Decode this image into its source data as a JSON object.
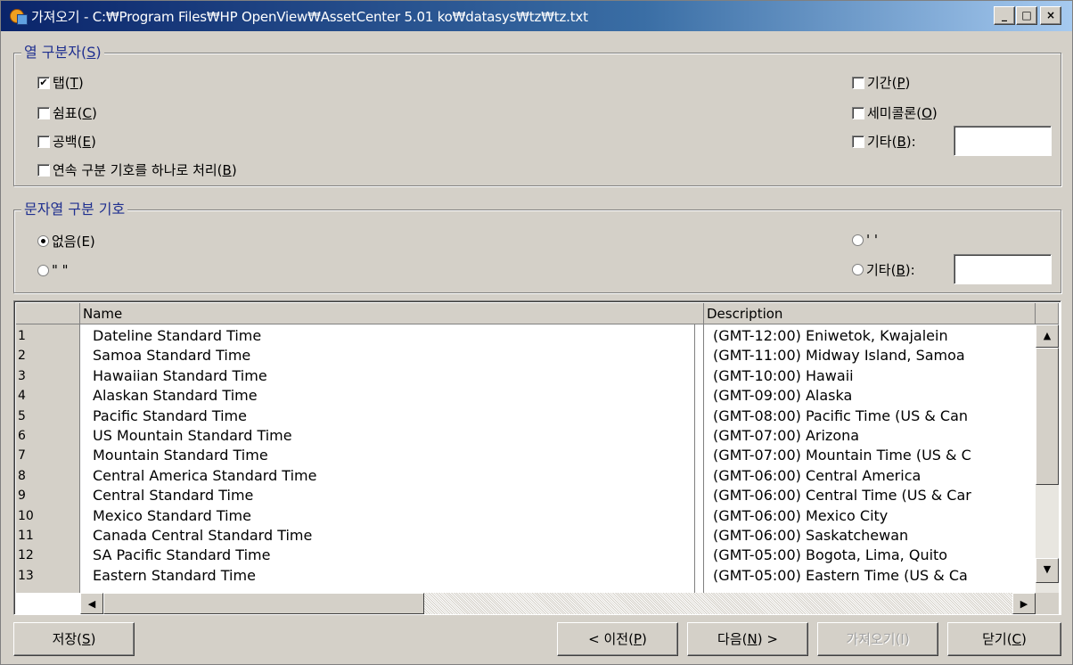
{
  "window": {
    "title": "가져오기 - C:₩Program Files₩HP OpenView₩AssetCenter 5.01 ko₩datasys₩tz₩tz.txt",
    "minimize": "_",
    "maximize": "□",
    "close": "×"
  },
  "column_separator": {
    "legend_pre": "열 구분자(",
    "legend_key": "S",
    "legend_post": ")",
    "tab": {
      "pre": "탭(",
      "key": "T",
      "post": ")",
      "checked": true
    },
    "comma": {
      "pre": "쉼표(",
      "key": "C",
      "post": ")",
      "checked": false
    },
    "space": {
      "pre": "공백(",
      "key": "E",
      "post": ")",
      "checked": false
    },
    "merge": {
      "pre": "연속 구분 기호를 하나로 처리(",
      "key": "B",
      "post": ")",
      "checked": false
    },
    "period": {
      "pre": "기간(",
      "key": "P",
      "post": ")",
      "checked": false
    },
    "semicolon": {
      "pre": "세미콜론(",
      "key": "O",
      "post": ")",
      "checked": false
    },
    "other": {
      "pre": "기타(",
      "key": "B",
      "post": "):",
      "checked": false,
      "value": ""
    }
  },
  "string_delimiter": {
    "legend": "문자열 구분 기호",
    "none": {
      "label": "없음(E)",
      "selected": true
    },
    "single_quote": {
      "label": "' '",
      "selected": false
    },
    "double_quote": {
      "label": "\" \"",
      "selected": false
    },
    "other": {
      "pre": "기타(",
      "key": "B",
      "post": "):",
      "selected": false,
      "value": ""
    }
  },
  "grid": {
    "columns": [
      "Name",
      "Description"
    ],
    "rows": [
      {
        "num": "1",
        "name": "Dateline Standard Time",
        "desc": "(GMT-12:00) Eniwetok, Kwajalein"
      },
      {
        "num": "2",
        "name": "Samoa Standard Time",
        "desc": "(GMT-11:00) Midway Island, Samoa"
      },
      {
        "num": "3",
        "name": "Hawaiian Standard Time",
        "desc": "(GMT-10:00) Hawaii"
      },
      {
        "num": "4",
        "name": "Alaskan Standard Time",
        "desc": "(GMT-09:00) Alaska"
      },
      {
        "num": "5",
        "name": "Pacific Standard Time",
        "desc": "(GMT-08:00) Pacific Time (US & Can"
      },
      {
        "num": "6",
        "name": "US Mountain Standard Time",
        "desc": "(GMT-07:00) Arizona"
      },
      {
        "num": "7",
        "name": "Mountain Standard Time",
        "desc": "(GMT-07:00) Mountain Time (US & C"
      },
      {
        "num": "8",
        "name": "Central America Standard Time",
        "desc": "(GMT-06:00) Central America"
      },
      {
        "num": "9",
        "name": "Central Standard Time",
        "desc": "(GMT-06:00) Central Time (US & Car"
      },
      {
        "num": "10",
        "name": "Mexico Standard Time",
        "desc": "(GMT-06:00) Mexico City"
      },
      {
        "num": "11",
        "name": "Canada Central Standard Time",
        "desc": "(GMT-06:00) Saskatchewan"
      },
      {
        "num": "12",
        "name": "SA Pacific Standard Time",
        "desc": "(GMT-05:00) Bogota, Lima, Quito"
      },
      {
        "num": "13",
        "name": "Eastern Standard Time",
        "desc": "(GMT-05:00) Eastern Time (US & Ca"
      }
    ]
  },
  "buttons": {
    "save": {
      "pre": "저장(",
      "key": "S",
      "post": ")"
    },
    "prev": {
      "pre": "< 이전(",
      "key": "P",
      "post": ")"
    },
    "next": {
      "pre": "다음(",
      "key": "N",
      "post": ") >"
    },
    "import": {
      "label": "가져오기(I)",
      "disabled": true
    },
    "close": {
      "pre": "닫기(",
      "key": "C",
      "post": ")"
    }
  }
}
